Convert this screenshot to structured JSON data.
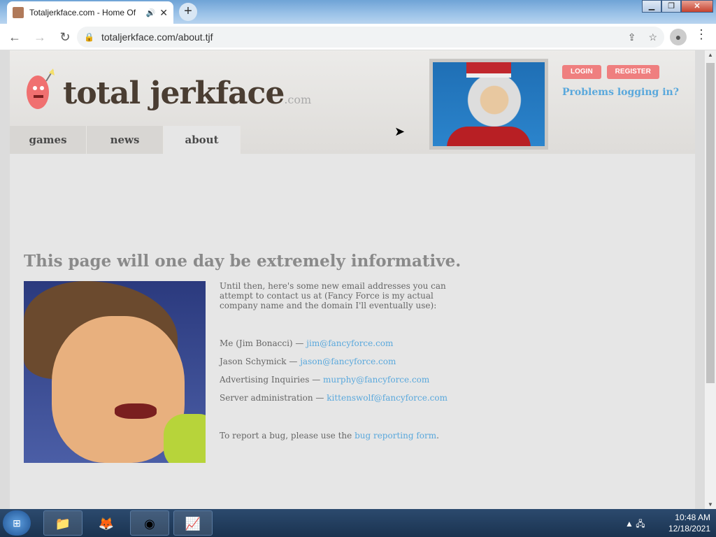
{
  "browser": {
    "tab_title": "Totaljerkface.com - Home Of",
    "url": "totaljerkface.com/about.tjf"
  },
  "site": {
    "logo_text": "total jerkface",
    "logo_suffix": ".com",
    "nav": [
      "games",
      "news",
      "about"
    ],
    "login_label": "LOGIN",
    "register_label": "REGISTER",
    "problems_label": "Problems logging in?"
  },
  "main": {
    "heading": "This page will one day be extremely informative.",
    "intro": "Until then, here's some new email addresses you can attempt to contact us at (Fancy Force is my actual company name and the domain I'll eventually use):",
    "contacts": [
      {
        "label": "Me (Jim Bonacci) —",
        "email": "jim@fancyforce.com"
      },
      {
        "label": "Jason Schymick —",
        "email": "jason@fancyforce.com"
      },
      {
        "label": "Advertising Inquiries —",
        "email": "murphy@fancyforce.com"
      },
      {
        "label": "Server administration —",
        "email": "kittenswolf@fancyforce.com"
      }
    ],
    "bug_text": "To report a bug, please use the",
    "bug_link": "bug reporting form",
    "bug_end": "."
  },
  "taskbar": {
    "time": "10:48 AM",
    "date": "12/18/2021"
  }
}
